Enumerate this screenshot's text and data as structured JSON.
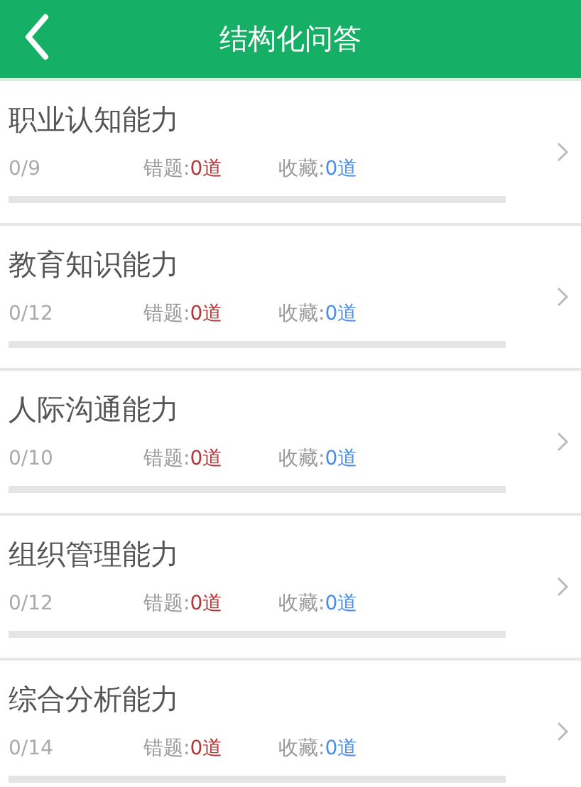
{
  "header": {
    "title": "结构化问答"
  },
  "items": [
    {
      "title": "职业认知能力",
      "progress": "0/9",
      "wrong_label": "错题:",
      "wrong": "0道",
      "fav_label": "收藏:",
      "fav": "0道",
      "level": 0
    },
    {
      "title": "教育知识能力",
      "progress": "0/12",
      "wrong_label": "错题:",
      "wrong": "0道",
      "fav_label": "收藏:",
      "fav": "0道",
      "level": 0
    },
    {
      "title": "人际沟通能力",
      "progress": "0/10",
      "wrong_label": "错题:",
      "wrong": "0道",
      "fav_label": "收藏:",
      "fav": "0道",
      "level": 0
    },
    {
      "title": "组织管理能力",
      "progress": "0/12",
      "wrong_label": "错题:",
      "wrong": "0道",
      "fav_label": "收藏:",
      "fav": "0道",
      "level": 0
    },
    {
      "title": "综合分析能力",
      "progress": "0/14",
      "wrong_label": "错题:",
      "wrong": "0道",
      "fav_label": "收藏:",
      "fav": "0道",
      "level": 0
    }
  ]
}
